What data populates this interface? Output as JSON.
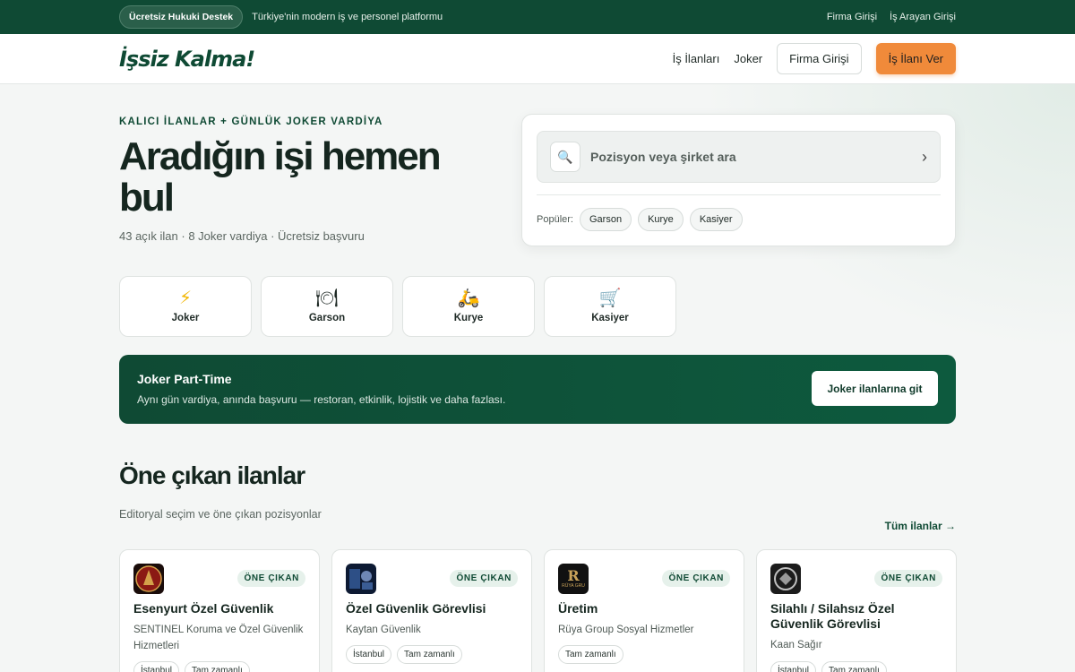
{
  "topbar": {
    "pill": "Ücretsiz Hukuki Destek",
    "tagline": "Türkiye'nin modern iş ve personel platformu",
    "links": [
      "Firma Girişi",
      "İş Arayan Girişi"
    ]
  },
  "header": {
    "logo": "İşsiz Kalma!",
    "nav": [
      "İş İlanları",
      "Joker"
    ],
    "login_button": "Firma Girişi",
    "post_job_button": "İş İlanı Ver"
  },
  "hero": {
    "eyebrow": "KALICI İLANLAR + GÜNLÜK JOKER VARDİYA",
    "title": "Aradığın işi hemen bul",
    "subtitle": "43 açık ilan · 8 Joker vardiya · Ücretsiz başvuru"
  },
  "search": {
    "placeholder": "Pozisyon veya şirket ara",
    "popular_label": "Popüler:",
    "popular": [
      "Garson",
      "Kurye",
      "Kasiyer"
    ]
  },
  "categories": [
    {
      "icon": "lightning-icon",
      "glyph": "⚡",
      "label": "Joker"
    },
    {
      "icon": "plate-icon",
      "glyph": "🍽",
      "label": "Garson"
    },
    {
      "icon": "scooter-icon",
      "glyph": "🛵",
      "label": "Kurye"
    },
    {
      "icon": "cart-icon",
      "glyph": "🛒",
      "label": "Kasiyer"
    }
  ],
  "banner": {
    "title": "Joker Part-Time",
    "description": "Aynı gün vardiya, anında başvuru — restoran, etkinlik, lojistik ve daha fazlası.",
    "button": "Joker ilanlarına git"
  },
  "featured": {
    "title": "Öne çıkan ilanlar",
    "subtitle": "Editoryal seçim ve öne çıkan pozisyonlar",
    "all_link": "Tüm ilanlar →",
    "badge": "ÖNE ÇIKAN",
    "cards": [
      {
        "title": "Esenyurt Özel Güvenlik",
        "company": "SENTINEL Koruma ve Özel Güvenlik Hizmetleri",
        "tags": [
          "İstanbul",
          "Tam zamanlı"
        ],
        "logo_color": "#8b1a14",
        "logo_text": ""
      },
      {
        "title": "Özel Güvenlik Görevlisi",
        "company": "Kaytan Güvenlik",
        "tags": [
          "İstanbul",
          "Tam zamanlı"
        ],
        "logo_color": "#1e2d4a",
        "logo_text": ""
      },
      {
        "title": "Üretim",
        "company": "Rüya Group Sosyal Hizmetler",
        "tags": [
          "Tam zamanlı"
        ],
        "logo_color": "#111111",
        "logo_text": "RÜYA GRU"
      },
      {
        "title": "Silahlı / Silahsız Özel Güvenlik Görevlisi",
        "company": "Kaan Sağır",
        "tags": [
          "İstanbul",
          "Tam zamanlı"
        ],
        "logo_color": "#2a2a2a",
        "logo_text": ""
      }
    ]
  }
}
